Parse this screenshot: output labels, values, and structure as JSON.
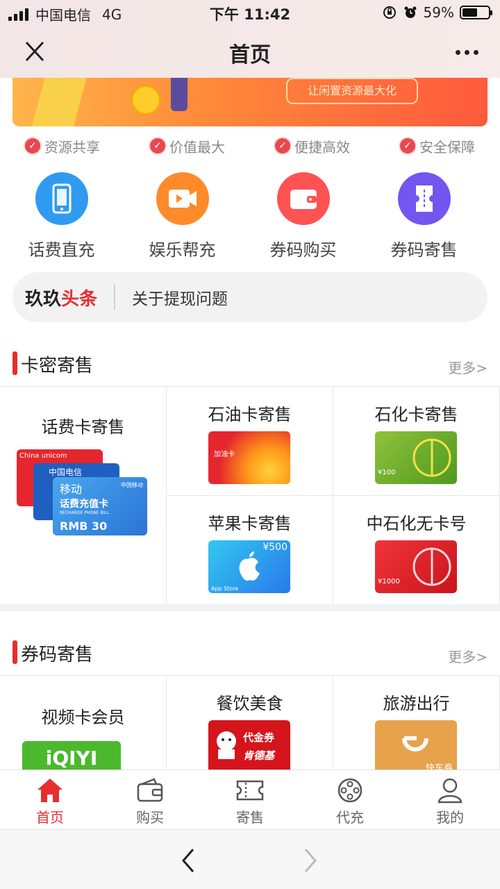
{
  "status": {
    "carrier": "中国电信",
    "network": "4G",
    "time": "下午 11:42",
    "battery": "59%",
    "battery_level": 0.59
  },
  "nav": {
    "title": "首页"
  },
  "banner": {
    "button_label": "让闲置资源最大化"
  },
  "features": [
    "资源共享",
    "价值最大",
    "便捷高效",
    "安全保障"
  ],
  "quick_actions": [
    {
      "label": "话费直充",
      "icon": "phone-icon",
      "color": "#2f9bf0"
    },
    {
      "label": "娱乐帮充",
      "icon": "video-icon",
      "color": "#ff8a2a"
    },
    {
      "label": "券码购买",
      "icon": "wallet-icon",
      "color": "#ff5252"
    },
    {
      "label": "券码寄售",
      "icon": "ticket-icon",
      "color": "#7256ef"
    }
  ],
  "news": {
    "brand_prefix": "玖玖",
    "brand_highlight": "头条",
    "headline": "关于提现问题"
  },
  "section_cards": {
    "title": "卡密寄售",
    "more": "更多>",
    "items": [
      {
        "title": "话费卡寄售"
      },
      {
        "title": "石油卡寄售",
        "card_text": "加油卡"
      },
      {
        "title": "石化卡寄售",
        "card_text": "¥100"
      },
      {
        "title": "苹果卡寄售",
        "card_text": "¥500",
        "card_sub": "App Store"
      },
      {
        "title": "中石化无卡号",
        "card_text": "¥1000"
      }
    ],
    "phone_cards": {
      "unicom": "China unicom",
      "telecom": "中国电信",
      "mobile_title": "移动",
      "mobile_sub": "话费充值卡",
      "mobile_en": "RECHARGE PHONE BILL",
      "mobile_value": "RMB 30",
      "mobile_brand": "中国移动"
    }
  },
  "section_coupons": {
    "title": "券码寄售",
    "more": "更多>",
    "items": [
      {
        "title": "视频卡会员",
        "card_text": "iQIYI"
      },
      {
        "title": "餐饮美食",
        "card_text": "代金券",
        "card_sub": "肯德基"
      },
      {
        "title": "旅游出行",
        "card_text": "快车券"
      }
    ]
  },
  "tabbar": [
    {
      "label": "首页",
      "active": true
    },
    {
      "label": "购买"
    },
    {
      "label": "寄售"
    },
    {
      "label": "代充"
    },
    {
      "label": "我的"
    }
  ],
  "colors": {
    "accent": "#e52e2e"
  }
}
